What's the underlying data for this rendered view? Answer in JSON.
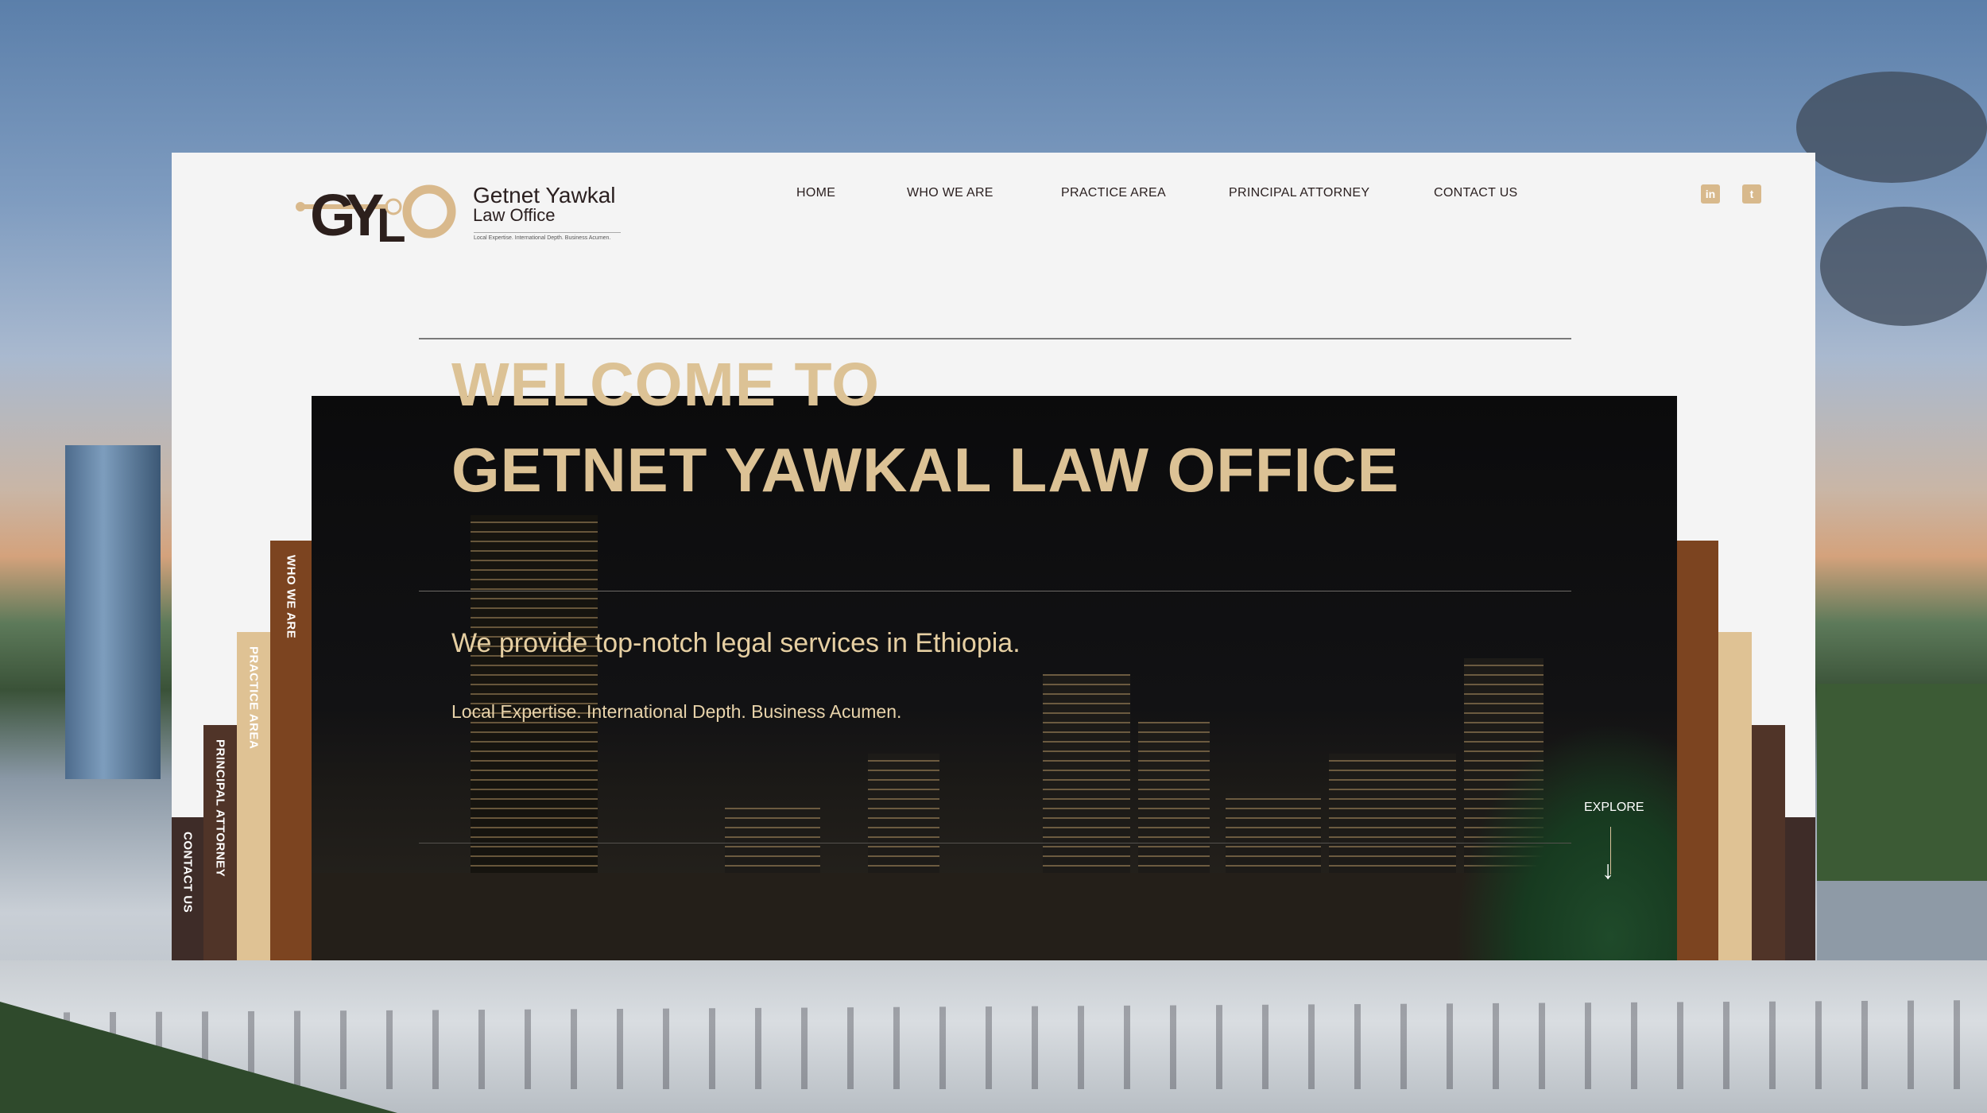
{
  "brand": {
    "mark": "GYLO",
    "name": "Getnet Yawkal",
    "subtitle": "Law Office",
    "tagline": "Local Expertise. International Depth. Business Acumen."
  },
  "nav": {
    "items": [
      {
        "label": "HOME"
      },
      {
        "label": "WHO WE ARE"
      },
      {
        "label": "PRACTICE AREA"
      },
      {
        "label": "PRINCIPAL ATTORNEY"
      },
      {
        "label": "CONTACT US"
      }
    ]
  },
  "social": {
    "linkedin": {
      "icon": "linkedin-icon",
      "glyph": "in"
    },
    "twitter": {
      "icon": "twitter-icon",
      "glyph": "t"
    }
  },
  "hero": {
    "welcome": "WELCOME TO",
    "title": "GETNET YAWKAL LAW OFFICE",
    "lead": "We provide top-notch legal services in Ethiopia.",
    "tagline": "Local Expertise. International Depth. Business Acumen.",
    "explore": "EXPLORE",
    "arrow": "↓"
  },
  "side_tabs": [
    {
      "label": "WHO WE ARE"
    },
    {
      "label": "PRACTICE AREA"
    },
    {
      "label": "PRINCIPAL ATTORNEY"
    },
    {
      "label": "CONTACT US"
    }
  ],
  "colors": {
    "gold": "#dcc295",
    "brown": "#7c4420",
    "tan": "#dfc294",
    "dark_brown": "#503428",
    "charcoal": "#3e2c28"
  }
}
